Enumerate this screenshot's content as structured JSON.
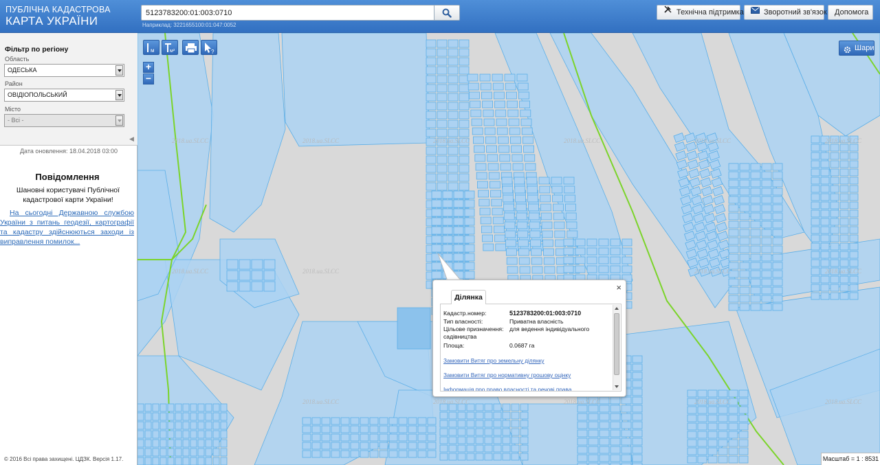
{
  "header": {
    "logo_line1": "Публічна кадастрова",
    "logo_line2": "Карта України",
    "search_value": "5123783200:01:003:0710",
    "search_hint": "Наприклад: 3221655100:01:047:0052",
    "buttons": [
      {
        "label": "Технічна підтримка",
        "icon": "wrench-screwdriver-icon"
      },
      {
        "label": "Зворотний зв'язок",
        "icon": "envelope-icon"
      },
      {
        "label": "Допомога"
      }
    ]
  },
  "sidebar": {
    "filter_title": "Фільтр по регіону",
    "region_label": "Область",
    "region_value": "Одеська",
    "district_label": "Район",
    "district_value": "Овідіопольський",
    "city_label": "Місто",
    "city_value": "- Всі -",
    "update_date": "Дата оновлення: 18.04.2018 03:00",
    "notice_title": "Повідомлення",
    "notice_body": "Шановні користувачі Публічної кадастрової карти України!",
    "notice_link": "На сьогодні Державною службою України з питань геодезії, картографії та кадастру здійснюються заходи із виправлення помилок...",
    "copyright": "© 2016 Всі права захищені. ЦДЗК. Версія 1.17."
  },
  "map": {
    "tools": [
      {
        "name": "measure-distance-icon",
        "text": "м"
      },
      {
        "name": "measure-area-icon",
        "text": "м²"
      },
      {
        "name": "print-icon"
      },
      {
        "name": "identify-icon",
        "text": "?"
      }
    ],
    "zoom_in": "+",
    "zoom_out": "−",
    "layers_label": "Шари",
    "watermark": "2018.ua.SLCC",
    "scale": "Масштаб = 1 : 8531",
    "colors": {
      "parcel_fill": "#acd2f2",
      "parcel_stroke": "#5aaee8",
      "boundary": "#7bd42a",
      "background": "#d9d9d9"
    }
  },
  "popup": {
    "tab": "Ділянка",
    "close": "×",
    "rows": [
      {
        "label": "Кадастр.номер:",
        "value": "5123783200:01:003:0710",
        "bold": true
      },
      {
        "label": "Тип власності:",
        "value": "Приватна власність"
      },
      {
        "label": "Цільове призначення:",
        "value": "для ведення індивідуального"
      },
      {
        "label": "садівництва",
        "value": ""
      },
      {
        "label": "Площа:",
        "value": "0.0687 га"
      }
    ],
    "links": [
      "Замовити Витяг про земельну ділянку",
      "Замовити Витяг про нормативну грошову оцінку",
      "Інформація про право власності та речові права"
    ]
  }
}
